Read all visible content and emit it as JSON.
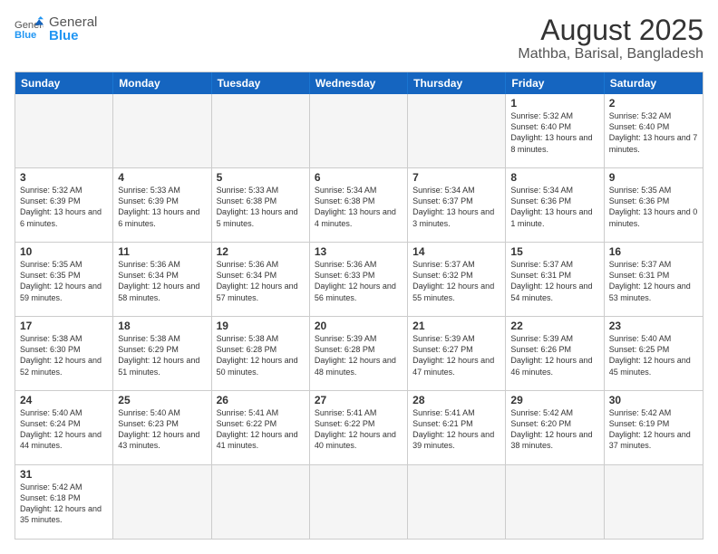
{
  "header": {
    "logo_text_general": "General",
    "logo_text_blue": "Blue",
    "title": "August 2025",
    "subtitle": "Mathba, Barisal, Bangladesh"
  },
  "calendar": {
    "days_of_week": [
      "Sunday",
      "Monday",
      "Tuesday",
      "Wednesday",
      "Thursday",
      "Friday",
      "Saturday"
    ],
    "weeks": [
      [
        {
          "day": "",
          "empty": true
        },
        {
          "day": "",
          "empty": true
        },
        {
          "day": "",
          "empty": true
        },
        {
          "day": "",
          "empty": true
        },
        {
          "day": "",
          "empty": true
        },
        {
          "day": "1",
          "sunrise": "Sunrise: 5:32 AM",
          "sunset": "Sunset: 6:40 PM",
          "daylight": "Daylight: 13 hours and 8 minutes."
        },
        {
          "day": "2",
          "sunrise": "Sunrise: 5:32 AM",
          "sunset": "Sunset: 6:40 PM",
          "daylight": "Daylight: 13 hours and 7 minutes."
        }
      ],
      [
        {
          "day": "3",
          "sunrise": "Sunrise: 5:32 AM",
          "sunset": "Sunset: 6:39 PM",
          "daylight": "Daylight: 13 hours and 6 minutes."
        },
        {
          "day": "4",
          "sunrise": "Sunrise: 5:33 AM",
          "sunset": "Sunset: 6:39 PM",
          "daylight": "Daylight: 13 hours and 6 minutes."
        },
        {
          "day": "5",
          "sunrise": "Sunrise: 5:33 AM",
          "sunset": "Sunset: 6:38 PM",
          "daylight": "Daylight: 13 hours and 5 minutes."
        },
        {
          "day": "6",
          "sunrise": "Sunrise: 5:34 AM",
          "sunset": "Sunset: 6:38 PM",
          "daylight": "Daylight: 13 hours and 4 minutes."
        },
        {
          "day": "7",
          "sunrise": "Sunrise: 5:34 AM",
          "sunset": "Sunset: 6:37 PM",
          "daylight": "Daylight: 13 hours and 3 minutes."
        },
        {
          "day": "8",
          "sunrise": "Sunrise: 5:34 AM",
          "sunset": "Sunset: 6:36 PM",
          "daylight": "Daylight: 13 hours and 1 minute."
        },
        {
          "day": "9",
          "sunrise": "Sunrise: 5:35 AM",
          "sunset": "Sunset: 6:36 PM",
          "daylight": "Daylight: 13 hours and 0 minutes."
        }
      ],
      [
        {
          "day": "10",
          "sunrise": "Sunrise: 5:35 AM",
          "sunset": "Sunset: 6:35 PM",
          "daylight": "Daylight: 12 hours and 59 minutes."
        },
        {
          "day": "11",
          "sunrise": "Sunrise: 5:36 AM",
          "sunset": "Sunset: 6:34 PM",
          "daylight": "Daylight: 12 hours and 58 minutes."
        },
        {
          "day": "12",
          "sunrise": "Sunrise: 5:36 AM",
          "sunset": "Sunset: 6:34 PM",
          "daylight": "Daylight: 12 hours and 57 minutes."
        },
        {
          "day": "13",
          "sunrise": "Sunrise: 5:36 AM",
          "sunset": "Sunset: 6:33 PM",
          "daylight": "Daylight: 12 hours and 56 minutes."
        },
        {
          "day": "14",
          "sunrise": "Sunrise: 5:37 AM",
          "sunset": "Sunset: 6:32 PM",
          "daylight": "Daylight: 12 hours and 55 minutes."
        },
        {
          "day": "15",
          "sunrise": "Sunrise: 5:37 AM",
          "sunset": "Sunset: 6:31 PM",
          "daylight": "Daylight: 12 hours and 54 minutes."
        },
        {
          "day": "16",
          "sunrise": "Sunrise: 5:37 AM",
          "sunset": "Sunset: 6:31 PM",
          "daylight": "Daylight: 12 hours and 53 minutes."
        }
      ],
      [
        {
          "day": "17",
          "sunrise": "Sunrise: 5:38 AM",
          "sunset": "Sunset: 6:30 PM",
          "daylight": "Daylight: 12 hours and 52 minutes."
        },
        {
          "day": "18",
          "sunrise": "Sunrise: 5:38 AM",
          "sunset": "Sunset: 6:29 PM",
          "daylight": "Daylight: 12 hours and 51 minutes."
        },
        {
          "day": "19",
          "sunrise": "Sunrise: 5:38 AM",
          "sunset": "Sunset: 6:28 PM",
          "daylight": "Daylight: 12 hours and 50 minutes."
        },
        {
          "day": "20",
          "sunrise": "Sunrise: 5:39 AM",
          "sunset": "Sunset: 6:28 PM",
          "daylight": "Daylight: 12 hours and 48 minutes."
        },
        {
          "day": "21",
          "sunrise": "Sunrise: 5:39 AM",
          "sunset": "Sunset: 6:27 PM",
          "daylight": "Daylight: 12 hours and 47 minutes."
        },
        {
          "day": "22",
          "sunrise": "Sunrise: 5:39 AM",
          "sunset": "Sunset: 6:26 PM",
          "daylight": "Daylight: 12 hours and 46 minutes."
        },
        {
          "day": "23",
          "sunrise": "Sunrise: 5:40 AM",
          "sunset": "Sunset: 6:25 PM",
          "daylight": "Daylight: 12 hours and 45 minutes."
        }
      ],
      [
        {
          "day": "24",
          "sunrise": "Sunrise: 5:40 AM",
          "sunset": "Sunset: 6:24 PM",
          "daylight": "Daylight: 12 hours and 44 minutes."
        },
        {
          "day": "25",
          "sunrise": "Sunrise: 5:40 AM",
          "sunset": "Sunset: 6:23 PM",
          "daylight": "Daylight: 12 hours and 43 minutes."
        },
        {
          "day": "26",
          "sunrise": "Sunrise: 5:41 AM",
          "sunset": "Sunset: 6:22 PM",
          "daylight": "Daylight: 12 hours and 41 minutes."
        },
        {
          "day": "27",
          "sunrise": "Sunrise: 5:41 AM",
          "sunset": "Sunset: 6:22 PM",
          "daylight": "Daylight: 12 hours and 40 minutes."
        },
        {
          "day": "28",
          "sunrise": "Sunrise: 5:41 AM",
          "sunset": "Sunset: 6:21 PM",
          "daylight": "Daylight: 12 hours and 39 minutes."
        },
        {
          "day": "29",
          "sunrise": "Sunrise: 5:42 AM",
          "sunset": "Sunset: 6:20 PM",
          "daylight": "Daylight: 12 hours and 38 minutes."
        },
        {
          "day": "30",
          "sunrise": "Sunrise: 5:42 AM",
          "sunset": "Sunset: 6:19 PM",
          "daylight": "Daylight: 12 hours and 37 minutes."
        }
      ],
      [
        {
          "day": "31",
          "sunrise": "Sunrise: 5:42 AM",
          "sunset": "Sunset: 6:18 PM",
          "daylight": "Daylight: 12 hours and 35 minutes."
        },
        {
          "day": "",
          "empty": true
        },
        {
          "day": "",
          "empty": true
        },
        {
          "day": "",
          "empty": true
        },
        {
          "day": "",
          "empty": true
        },
        {
          "day": "",
          "empty": true
        },
        {
          "day": "",
          "empty": true
        }
      ]
    ]
  }
}
